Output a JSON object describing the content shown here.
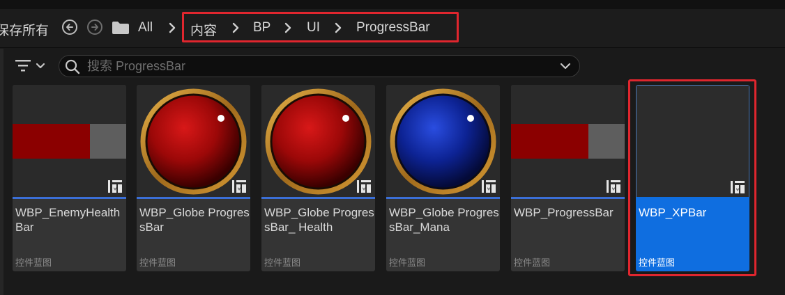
{
  "toolbar": {
    "save_all_label": "保存所有",
    "back_icon": "arrow-left-circle-icon",
    "forward_icon": "arrow-right-circle-icon",
    "folder_icon": "folder-icon"
  },
  "breadcrumb": {
    "items": [
      "All",
      "内容",
      "BP",
      "UI",
      "ProgressBar"
    ],
    "highlight_color": "#e0262e"
  },
  "search": {
    "placeholder": "搜索 ProgressBar",
    "value": ""
  },
  "assets": [
    {
      "name": "WBP_EnemyHealth Bar",
      "type": "控件蓝图",
      "thumbnail": "red-grey-bar",
      "selected": false
    },
    {
      "name": "WBP_Globe ProgressBar",
      "type": "控件蓝图",
      "thumbnail": "red-globe",
      "selected": false
    },
    {
      "name": "WBP_Globe ProgressBar_ Health",
      "type": "控件蓝图",
      "thumbnail": "red-globe",
      "selected": false
    },
    {
      "name": "WBP_Globe ProgressBar_Mana",
      "type": "控件蓝图",
      "thumbnail": "blue-globe",
      "selected": false
    },
    {
      "name": "WBP_ProgressBar",
      "type": "控件蓝图",
      "thumbnail": "red-grey-bar",
      "selected": false
    },
    {
      "name": "WBP_XPBar",
      "type": "控件蓝图",
      "thumbnail": "empty",
      "selected": true
    }
  ],
  "colors": {
    "selection": "#0f6ee0",
    "accent_stripe": "#3b6fd6",
    "health_red": "#8b0000",
    "mana_blue": "#0a1f7a",
    "globe_rim": "#b8862a"
  }
}
